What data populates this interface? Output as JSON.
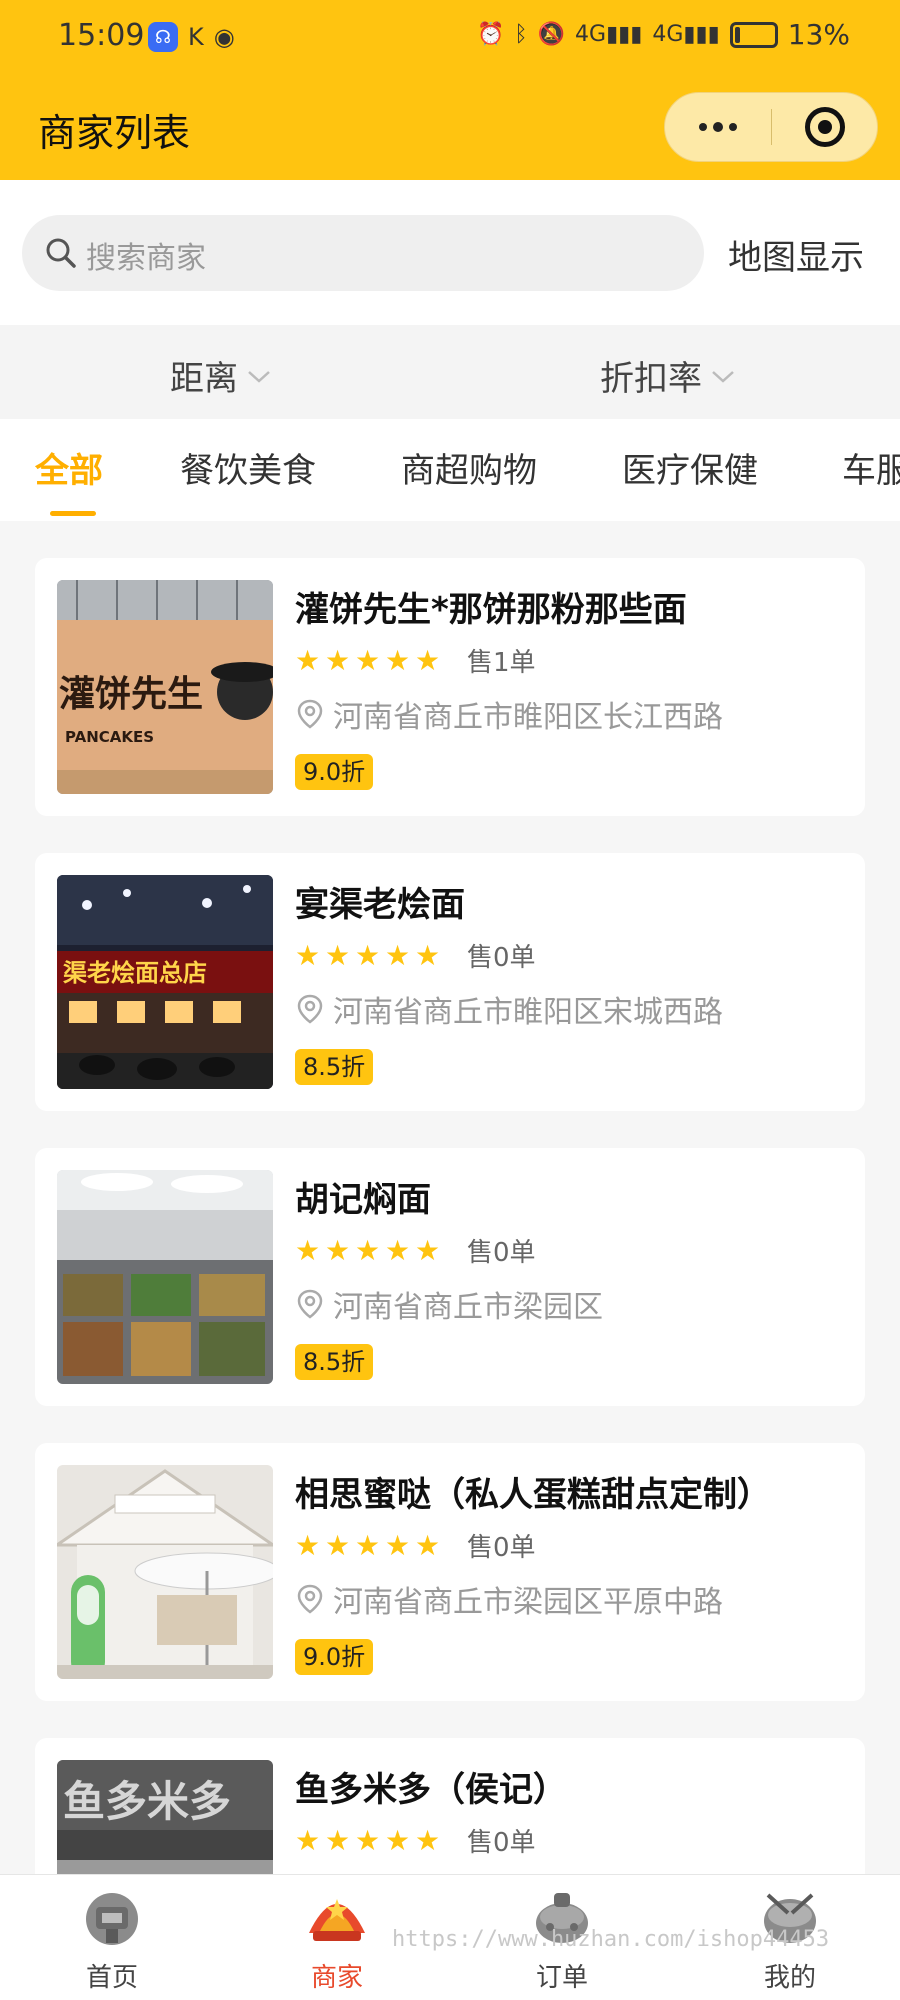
{
  "status_bar": {
    "time": "15:09",
    "left_icons": [
      "shield-app-icon",
      "k-app-icon",
      "eye-icon"
    ],
    "network": "4G",
    "battery_level": 0.13,
    "battery_text": "13%"
  },
  "header": {
    "title": "商家列表"
  },
  "search": {
    "placeholder": "搜索商家",
    "map_link": "地图显示"
  },
  "sort": {
    "items": [
      {
        "label": "距离"
      },
      {
        "label": "折扣率"
      }
    ]
  },
  "categories": {
    "active_index": 0,
    "tabs": [
      {
        "label": "全部"
      },
      {
        "label": "餐饮美食"
      },
      {
        "label": "商超购物"
      },
      {
        "label": "医疗保健"
      },
      {
        "label": "车服"
      }
    ]
  },
  "merchants": [
    {
      "name": "灌饼先生*那饼那粉那些面",
      "rating": 5,
      "sold": "售1单",
      "address": "河南省商丘市睢阳区长江西路",
      "discount": "9.0折",
      "photo_text": "灌饼先生",
      "photo_subtext": "PANCAKES"
    },
    {
      "name": "宴渠老烩面",
      "rating": 5,
      "sold": "售0单",
      "address": "河南省商丘市睢阳区宋城西路",
      "discount": "8.5折",
      "photo_text": "渠老烩面总店"
    },
    {
      "name": "胡记焖面",
      "rating": 5,
      "sold": "售0单",
      "address": "河南省商丘市梁园区",
      "discount": "8.5折"
    },
    {
      "name": "相思蜜哒（私人蛋糕甜点定制）",
      "rating": 5,
      "sold": "售0单",
      "address": "河南省商丘市梁园区平原中路",
      "discount": "9.0折"
    },
    {
      "name": "鱼多米多（侯记）",
      "rating": 5,
      "sold": "售0单",
      "address": "",
      "discount": "",
      "photo_text": "鱼多米多"
    }
  ],
  "bottom_nav": {
    "active_index": 1,
    "items": [
      {
        "label": "首页",
        "icon": "home-icon"
      },
      {
        "label": "商家",
        "icon": "merchant-icon"
      },
      {
        "label": "订单",
        "icon": "order-icon"
      },
      {
        "label": "我的",
        "icon": "profile-icon"
      }
    ]
  },
  "watermark": "https://www.huzhan.com/ishop44453",
  "colors": {
    "accent": "#ffc410",
    "active_tab": "#ffaf00",
    "active_nav": "#e84a2c"
  }
}
